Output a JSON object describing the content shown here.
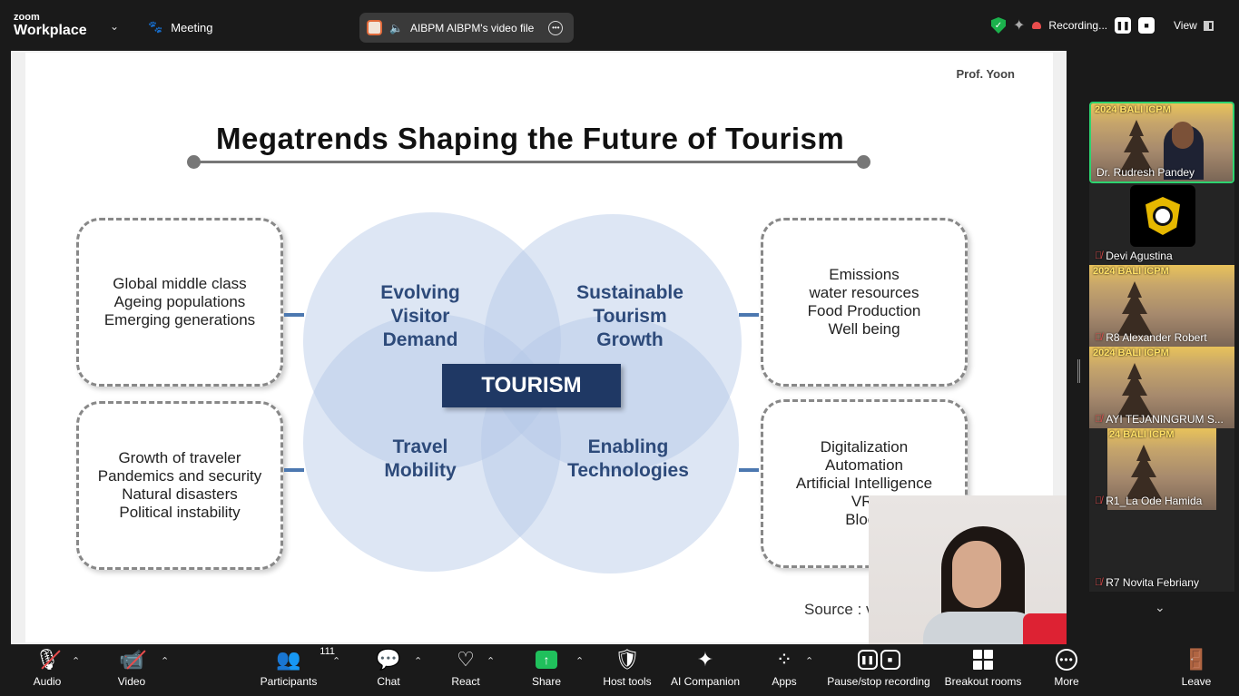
{
  "topbar": {
    "brand_small": "zoom",
    "brand_big": "Workplace",
    "meeting_label": "Meeting",
    "share_title": "AIBPM AIBPM's video file",
    "recording_label": "Recording...",
    "view_label": "View"
  },
  "slide": {
    "author": "Prof. Yoon",
    "title": "Megatrends Shaping the Future of Tourism",
    "center": "TOURISM",
    "circles": {
      "top_left": [
        "Evolving",
        "Visitor",
        "Demand"
      ],
      "top_right": [
        "Sustainable",
        "Tourism",
        "Growth"
      ],
      "bottom_left": [
        "Travel",
        "Mobility"
      ],
      "bottom_right": [
        "Enabling",
        "Technologies"
      ]
    },
    "boxes": {
      "top_left": [
        "Global middle class",
        "Ageing populations",
        "Emerging generations"
      ],
      "top_right": [
        "Emissions",
        "water resources",
        "Food Production",
        "Well being"
      ],
      "bottom_left": [
        "Growth of traveler",
        "Pandemics and security",
        "Natural disasters",
        "Political instability"
      ],
      "bottom_right": [
        "Digitalization",
        "Automation",
        "Artificial Intelligence",
        "VR,",
        "Block"
      ]
    },
    "source": "Source : v"
  },
  "participants_panel": [
    {
      "name": "Dr. Rudresh Pandey",
      "banner": "2024 BALI ICPM",
      "muted": false
    },
    {
      "name": "Devi Agustina",
      "banner": "",
      "muted": true
    },
    {
      "name": "R8 Alexander Robert",
      "banner": "2024 BALI ICPM",
      "muted": true
    },
    {
      "name": "AYI TEJANINGRUM S...",
      "banner": "2024 BALI ICPM",
      "muted": true
    },
    {
      "name": "R1_La Ode Hamida",
      "banner": "24 BALI ICPM",
      "muted": true
    },
    {
      "name": "R7 Novita Febriany",
      "banner": "",
      "muted": true
    }
  ],
  "toolbar": {
    "audio": "Audio",
    "video": "Video",
    "participants": "Participants",
    "participants_count": "111",
    "chat": "Chat",
    "react": "React",
    "share": "Share",
    "host_tools": "Host tools",
    "ai_companion": "AI Companion",
    "apps": "Apps",
    "pause_stop": "Pause/stop recording",
    "breakout": "Breakout rooms",
    "more": "More",
    "leave": "Leave"
  },
  "colors": {
    "accent_green": "#20c05c",
    "record_red": "#e94d4d",
    "slide_navy": "#1f3864",
    "circle_text": "#2d4a7a"
  }
}
